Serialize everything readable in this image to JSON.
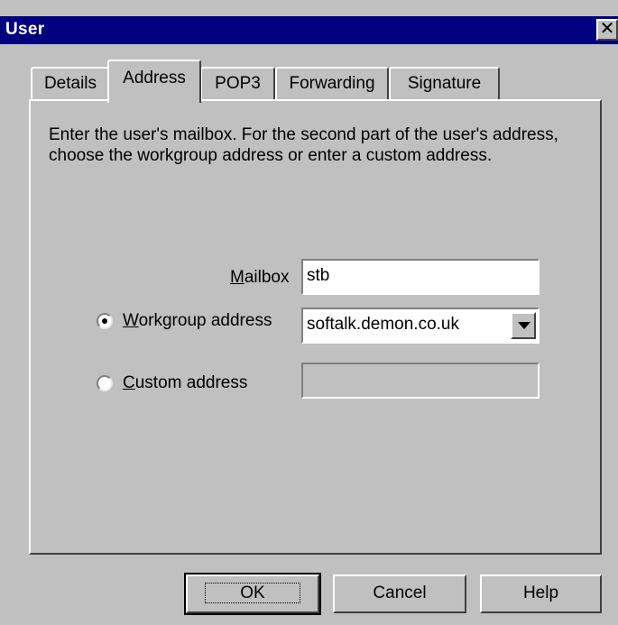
{
  "window": {
    "title": "User",
    "close_glyph": "✕"
  },
  "tabs": [
    {
      "label": "Details",
      "active": false
    },
    {
      "label": "Address",
      "active": true
    },
    {
      "label": "POP3",
      "active": false
    },
    {
      "label": "Forwarding",
      "active": false
    },
    {
      "label": "Signature",
      "active": false
    }
  ],
  "address_tab": {
    "instructions": "Enter the user's mailbox. For the second part of the user's address, choose the workgroup address or enter a custom address.",
    "mailbox": {
      "label_accel": "M",
      "label_rest": "ailbox",
      "value": "stb"
    },
    "workgroup": {
      "label_accel": "W",
      "label_rest": "orkgroup address",
      "selected": true,
      "value": "softalk.demon.co.uk"
    },
    "custom": {
      "label_accel": "C",
      "label_rest": "ustom address",
      "selected": false,
      "value": ""
    }
  },
  "buttons": {
    "ok": "OK",
    "cancel": "Cancel",
    "help": "Help"
  },
  "colors": {
    "title_bar": "#000080",
    "face": "#c0c0c0"
  },
  "icons": {
    "close": "close-icon",
    "dropdown": "chevron-down-icon"
  }
}
